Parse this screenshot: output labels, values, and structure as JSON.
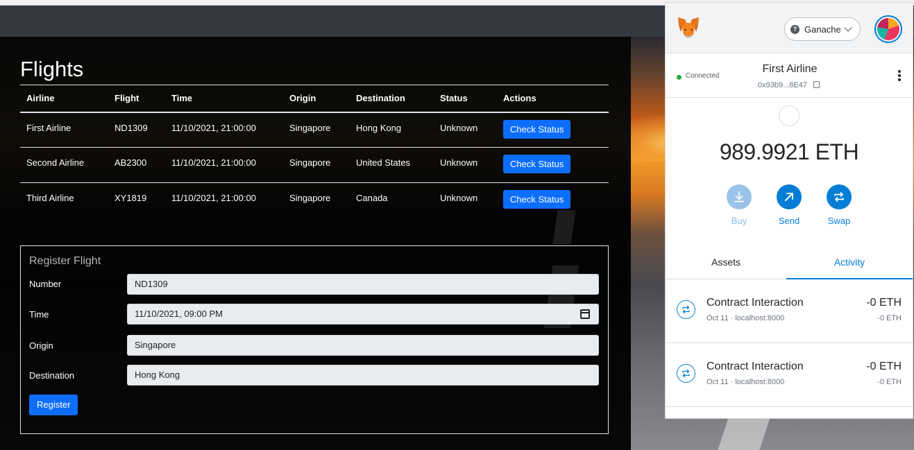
{
  "page": {
    "title": "Flights"
  },
  "flights_table": {
    "headers": [
      "Airline",
      "Flight",
      "Time",
      "Origin",
      "Destination",
      "Status",
      "Actions"
    ],
    "rows": [
      {
        "airline": "First Airline",
        "flight": "ND1309",
        "time": "11/10/2021, 21:00:00",
        "origin": "Singapore",
        "destination": "Hong Kong",
        "status": "Unknown",
        "action": "Check Status"
      },
      {
        "airline": "Second Airline",
        "flight": "AB2300",
        "time": "11/10/2021, 21:00:00",
        "origin": "Singapore",
        "destination": "United States",
        "status": "Unknown",
        "action": "Check Status"
      },
      {
        "airline": "Third Airline",
        "flight": "XY1819",
        "time": "11/10/2021, 21:00:00",
        "origin": "Singapore",
        "destination": "Canada",
        "status": "Unknown",
        "action": "Check Status"
      }
    ]
  },
  "register_form": {
    "title": "Register Flight",
    "fields": [
      {
        "label": "Number",
        "value": "ND1309"
      },
      {
        "label": "Time",
        "value": "11/10/2021, 09:00 PM"
      },
      {
        "label": "Origin",
        "value": "Singapore"
      },
      {
        "label": "Destination",
        "value": "Hong Kong"
      }
    ],
    "submit_label": "Register"
  },
  "metamask": {
    "network": "Ganache",
    "connection_status": "Connected",
    "account_name": "First Airline",
    "account_address": "0x93b9...8E47",
    "balance": "989.9921 ETH",
    "actions": [
      {
        "label": "Buy",
        "icon": "download-icon",
        "enabled": false
      },
      {
        "label": "Send",
        "icon": "arrow-up-right-icon",
        "enabled": true
      },
      {
        "label": "Swap",
        "icon": "swap-icon",
        "enabled": true
      }
    ],
    "tabs": [
      {
        "label": "Assets",
        "active": false
      },
      {
        "label": "Activity",
        "active": true
      }
    ],
    "activity": [
      {
        "title": "Contract Interaction",
        "subtitle": "Oct 11 · localhost:8000",
        "amount": "-0 ETH",
        "amount_secondary": "-0 ETH"
      },
      {
        "title": "Contract Interaction",
        "subtitle": "Oct 11 · localhost:8000",
        "amount": "-0 ETH",
        "amount_secondary": "-0 ETH"
      }
    ],
    "colors": {
      "accent": "#037dd6",
      "connected": "#28a745"
    }
  },
  "colors": {
    "primary_button": "#0d6efd",
    "navbar": "#343a40"
  }
}
